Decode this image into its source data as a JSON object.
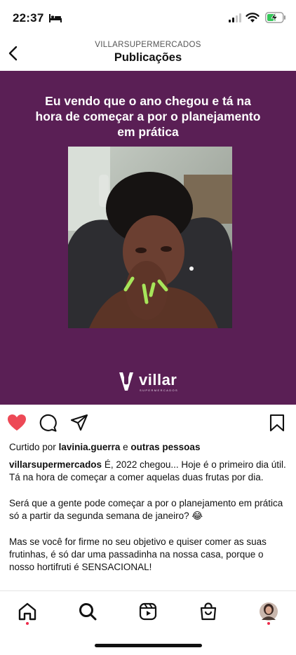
{
  "status_bar": {
    "time": "22:37",
    "icons": [
      "bed-icon",
      "signal-icon",
      "wifi-icon",
      "battery-charging-icon"
    ]
  },
  "header": {
    "account": "VILLARSUPERMERCADOS",
    "title": "Publicações",
    "back_icon": "chevron-left-icon"
  },
  "post": {
    "headline": "Eu vendo que o ano chegou e tá na hora de começar a por o planejamento em prática",
    "brand_logo_text": "villar",
    "brand_logo_subtext": "SUPERMERCADOS",
    "background_color": "#5a1f55"
  },
  "actions": {
    "like_icon": "heart-filled-icon",
    "comment_icon": "comment-icon",
    "share_icon": "send-icon",
    "save_icon": "bookmark-icon",
    "like_color": "#ed4956"
  },
  "likes": {
    "prefix": "Curtido por",
    "user": "lavinia.guerra",
    "connector": "e",
    "others": "outras pessoas"
  },
  "caption": {
    "username": "villarsupermercados",
    "paragraph1": "É, 2022 chegou... Hoje é o primeiro dia útil. Tá na hora de começar a comer aquelas duas frutas por dia.",
    "paragraph2": "Será que a gente pode começar a por o planejamento em prática só a partir da segunda semana de janeiro? 😂",
    "paragraph3": "Mas se você for firme no seu objetivo e quiser comer as suas frutinhas, é só dar uma passadinha na nossa casa, porque o nosso hortifruti é SENSACIONAL!"
  },
  "bottom_nav": {
    "items": [
      "home-icon",
      "search-icon",
      "reels-icon",
      "shop-icon",
      "profile-avatar"
    ],
    "dot_color": "#ed2a4a"
  }
}
